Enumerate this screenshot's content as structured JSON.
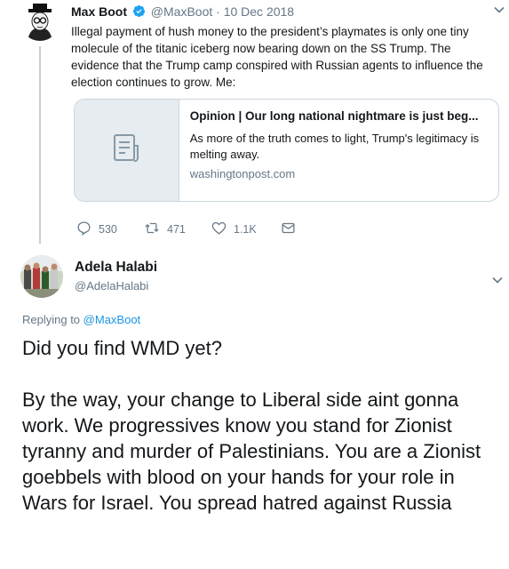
{
  "tweet1": {
    "name": "Max Boot",
    "handle": "@MaxBoot",
    "separator": "·",
    "date": "10 Dec 2018",
    "text": "Illegal payment of hush money to the president’s playmates is only one tiny molecule of the titanic iceberg now bearing down on the SS Trump. The evidence that the Trump camp conspired with Russian agents to influence the election continues to grow. Me:",
    "card": {
      "title": "Opinion | Our long national nightmare is just beg...",
      "description": "As more of the truth comes to light, Trump's legitimacy is melting away.",
      "domain": "washingtonpost.com"
    },
    "actions": {
      "replies": "530",
      "retweets": "471",
      "likes": "1.1K"
    }
  },
  "tweet2": {
    "name": "Adela Halabi",
    "handle": "@AdelaHalabi",
    "replying_prefix": "Replying to",
    "replying_to": "@MaxBoot",
    "text": "Did you find WMD yet?\n\nBy the way, your change to Liberal side aint gonna work. We progressives know you stand for Zionist tyranny and murder of Palestinians. You are a Zionist goebbels with blood on your hands for your role in Wars for Israel. You spread hatred against Russia"
  },
  "colors": {
    "accent": "#1b95e0",
    "muted": "#657786",
    "border": "#ccd6dd"
  },
  "icons": [
    "verified-icon",
    "chevron-down-icon",
    "article-icon",
    "reply-icon",
    "retweet-icon",
    "like-icon",
    "dm-icon"
  ]
}
